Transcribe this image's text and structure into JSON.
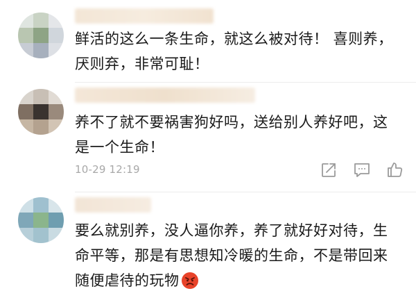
{
  "comments": [
    {
      "lines": [
        "鲜活的这么一条生命，就这么被对待！ 喜则养，",
        "厌则弃，非常可耻！"
      ]
    },
    {
      "lines": [
        "养不了就不要祸害狗好吗，送给别人养好吧，这",
        "是一个生命！"
      ],
      "timestamp": "10-29 12:19",
      "actions": [
        "share-icon",
        "comment-icon",
        "like-icon"
      ]
    },
    {
      "lines": [
        "要么就别养，没人逼你养，养了就好好对待，生",
        "命平等，那是有思想知冷暖的生命，不是带回来",
        "随便虐待的玩物"
      ],
      "emoji": "angry-face-emoji"
    }
  ],
  "colors": {
    "text": "#1a1a1a",
    "meta": "#a8a8a8",
    "icon": "#9a9a9a",
    "divider": "#ececec",
    "emoji": "#e8432a"
  }
}
